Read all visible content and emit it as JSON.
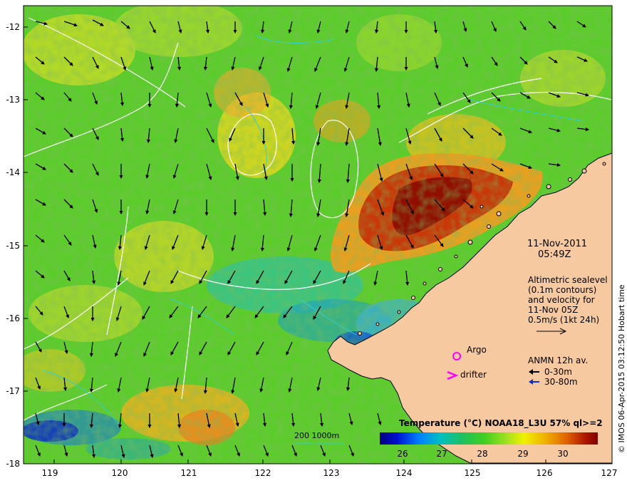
{
  "map": {
    "x_ticks": [
      "119",
      "120",
      "121",
      "122",
      "123",
      "124",
      "125",
      "126",
      "127"
    ],
    "y_ticks": [
      "-12",
      "-13",
      "-14",
      "-15",
      "-16",
      "-17",
      "-18"
    ],
    "date": "11-Nov-2011",
    "time": "05:49Z",
    "altimetry": {
      "line1": "Altimetric sealevel",
      "line2": "(0.1m contours)",
      "line3": "and velocity for",
      "line4": "11-Nov 05Z",
      "line5": "0.5m/s (1kt 24h)"
    },
    "legend": {
      "argo": "Argo",
      "drifter": "drifter",
      "anmn_title": "ANMN 12h av.",
      "anmn_shallow": "0-30m",
      "anmn_deep": "30-80m"
    },
    "bathymetry_label": "200  1000m",
    "colorbar": {
      "title": "Temperature (°C) NOAA18_L3U 57% ql>=2",
      "ticks": [
        "26",
        "27",
        "28",
        "29",
        "30"
      ]
    },
    "credit": "© IMOS 06-Apr-2015 03:12:50 Hobart time",
    "colors": {
      "land": "#f7c9a0",
      "argo": "#ff00ff",
      "anmn_deep": "#1030c0",
      "bathy_contour": "#30d0d0"
    }
  }
}
